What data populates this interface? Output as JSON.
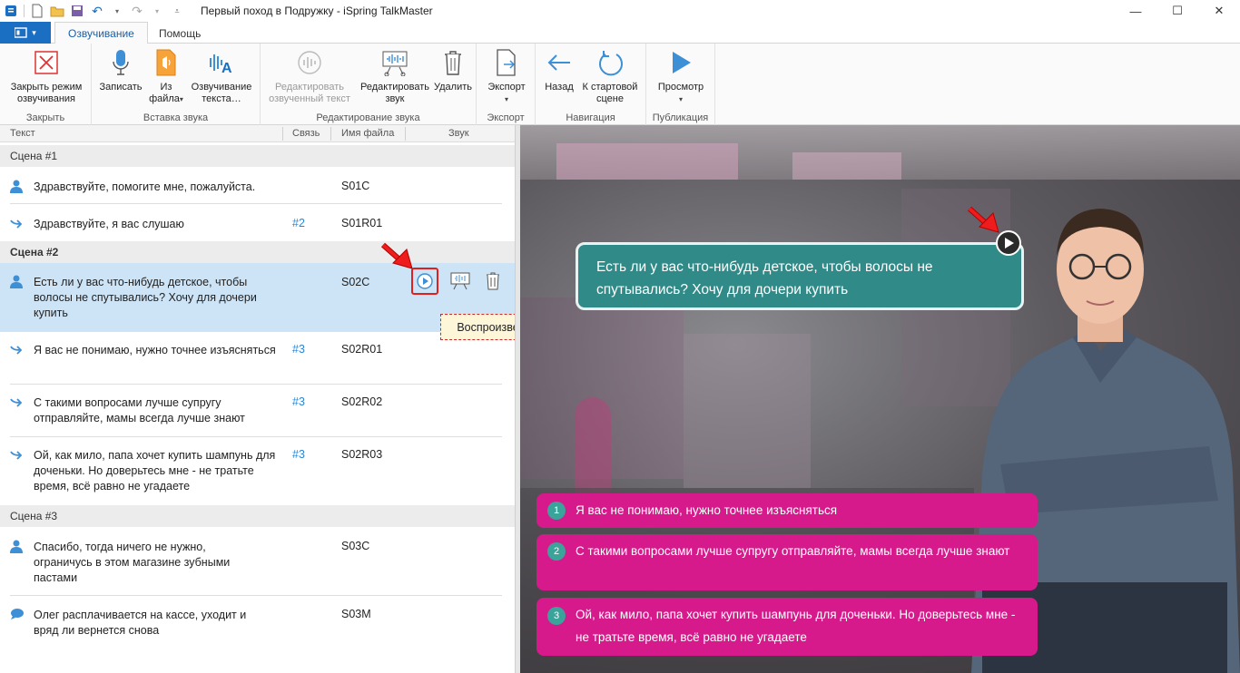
{
  "window": {
    "title": "Первый поход в Подружку - iSpring TalkMaster",
    "minimize": "—",
    "maximize": "☐",
    "close": "✕"
  },
  "ribbon": {
    "file_glyph": "▾",
    "tabs": [
      {
        "label": "Озвучивание",
        "active": true
      },
      {
        "label": "Помощь",
        "active": false
      }
    ],
    "groups": [
      {
        "label": "Закрыть",
        "buttons": [
          {
            "label1": "Закрыть режим",
            "label2": "озвучивания",
            "icon": "close-box-icon"
          }
        ]
      },
      {
        "label": "Вставка звука",
        "buttons": [
          {
            "label1": "Записать",
            "label2": "",
            "icon": "microphone-icon"
          },
          {
            "label1": "Из",
            "label2": "файла",
            "icon": "audio-file-icon",
            "dropdown": true
          },
          {
            "label1": "Озвучивание",
            "label2": "текста…",
            "icon": "text-to-speech-icon"
          }
        ]
      },
      {
        "label": "Редактирование звука",
        "buttons": [
          {
            "label1": "Редактировать",
            "label2": "озвученный текст",
            "icon": "edit-voiced-text-icon",
            "disabled": true
          },
          {
            "label1": "Редактировать",
            "label2": "звук",
            "icon": "waveform-edit-icon"
          },
          {
            "label1": "Удалить",
            "label2": "",
            "icon": "trash-icon"
          }
        ]
      },
      {
        "label": "Экспорт",
        "buttons": [
          {
            "label1": "Экспорт",
            "label2": "",
            "icon": "export-icon",
            "dropdown": true
          }
        ]
      },
      {
        "label": "Навигация",
        "buttons": [
          {
            "label1": "Назад",
            "label2": "",
            "icon": "arrow-left-icon"
          },
          {
            "label1": "К стартовой",
            "label2": "сцене",
            "icon": "restart-icon"
          }
        ]
      },
      {
        "label": "Публикация",
        "buttons": [
          {
            "label1": "Просмотр",
            "label2": "",
            "icon": "play-icon",
            "dropdown": true
          }
        ]
      }
    ]
  },
  "list": {
    "headers": {
      "text": "Текст",
      "link": "Связь",
      "file": "Имя файла",
      "sound": "Звук"
    },
    "scenes": [
      {
        "title": "Сцена #1"
      },
      {
        "title": "Сцена #2"
      },
      {
        "title": "Сцена #3"
      }
    ],
    "rows": [
      {
        "text": "Здравствуйте, помогите мне, пожалуйста.",
        "link": "",
        "file": "S01C",
        "icon": "user-icon"
      },
      {
        "text": "Здравствуйте, я вас слушаю",
        "link": "#2",
        "file": "S01R01",
        "icon": "reply-arrow-icon"
      },
      {
        "text": "Есть ли у вас что-нибудь детское, чтобы волосы не спутывались? Хочу для дочери купить",
        "link": "",
        "file": "S02C",
        "icon": "user-icon"
      },
      {
        "text": "Я вас не понимаю, нужно точнее изъясняться",
        "link": "#3",
        "file": "S02R01",
        "icon": "reply-arrow-icon"
      },
      {
        "text": "С такими вопросами лучше супругу отправляйте, мамы всегда лучше знают",
        "link": "#3",
        "file": "S02R02",
        "icon": "reply-arrow-icon"
      },
      {
        "text": "Ой, как мило, папа хочет купить шампунь для доченьки. Но доверьтесь мне - не тратьте время, всё равно не угадаете",
        "link": "#3",
        "file": "S02R03",
        "icon": "reply-arrow-icon"
      },
      {
        "text": "Спасибо, тогда ничего не нужно, ограничусь в этом магазине зубными пастами",
        "link": "",
        "file": "S03C",
        "icon": "user-icon"
      },
      {
        "text": "Олег расплачивается на кассе, уходит и вряд ли вернется снова",
        "link": "",
        "file": "S03M",
        "icon": "speech-bubble-icon"
      }
    ],
    "tooltip": "Воспроизвести"
  },
  "preview": {
    "question": "Есть ли у вас что-нибудь детское, чтобы волосы не спутывались? Хочу для дочери купить",
    "answers": [
      {
        "num": "1",
        "text": "Я вас не понимаю, нужно точнее изъясняться"
      },
      {
        "num": "2",
        "text": "С такими вопросами лучше супругу отправляйте, мамы всегда лучше знают"
      },
      {
        "num": "3",
        "text": "Ой, как мило, папа хочет купить шампунь для доченьки. Но доверьтесь мне - не тратьте время, всё равно не угадаете"
      }
    ]
  },
  "colors": {
    "accent": "#1a6fc3",
    "selection": "#cde4f7",
    "answer_bg": "#d61a8c",
    "question_bg": "#2f8a88",
    "link": "#2a86d1"
  }
}
